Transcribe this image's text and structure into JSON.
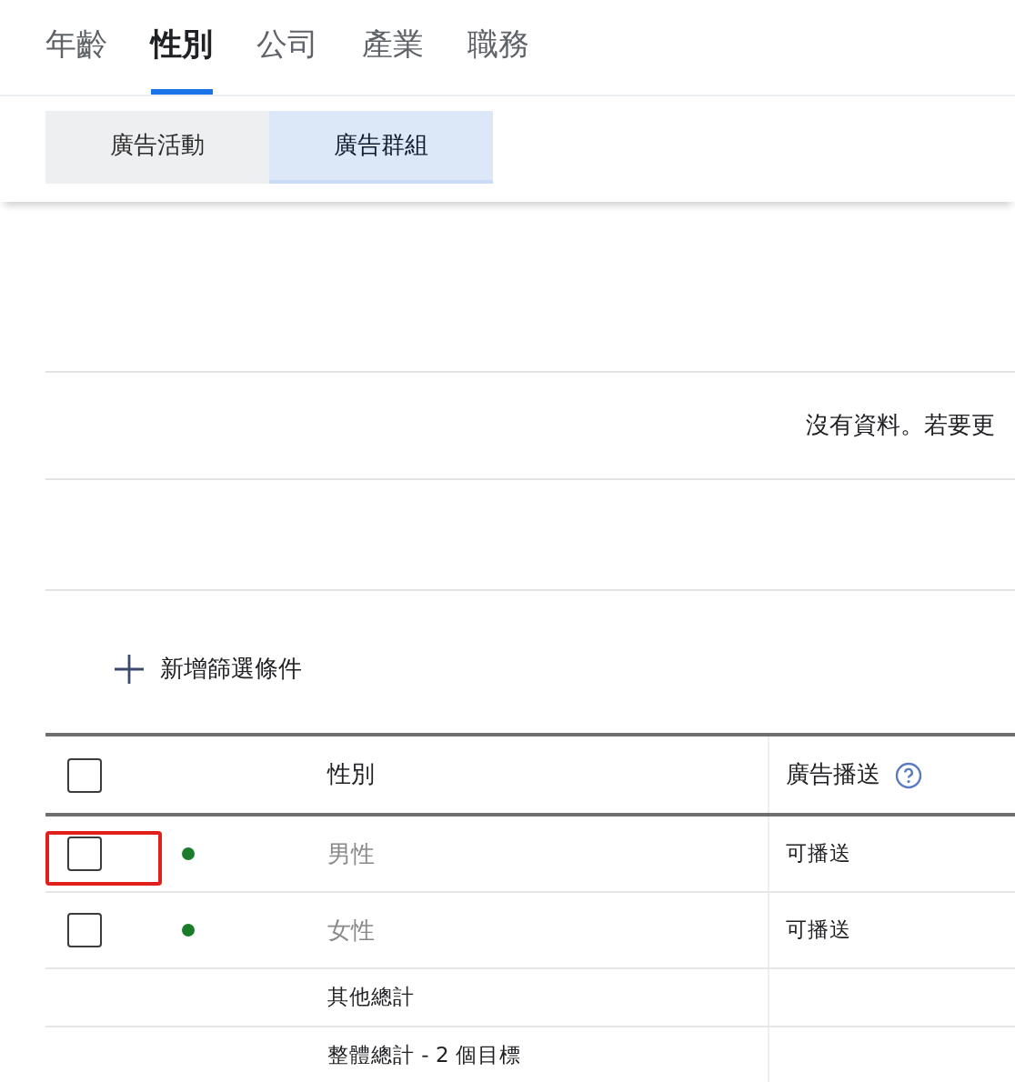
{
  "tabs": [
    {
      "label": "年齡",
      "selected": false
    },
    {
      "label": "性別",
      "selected": true
    },
    {
      "label": "公司",
      "selected": false
    },
    {
      "label": "產業",
      "selected": false
    },
    {
      "label": "職務",
      "selected": false
    }
  ],
  "subtabs": [
    {
      "label": "廣告活動",
      "selected": false
    },
    {
      "label": "廣告群組",
      "selected": true
    }
  ],
  "empty_message": "沒有資料。若要更",
  "add_filter": {
    "label": "新增篩選條件"
  },
  "table": {
    "header_checked": false,
    "columns": [
      "性別",
      "廣告播送"
    ],
    "rows": [
      {
        "kind": "item",
        "checked": false,
        "highlighted": true,
        "color": "#1b7d2b",
        "label": "男性",
        "delivery": "可播送"
      },
      {
        "kind": "item",
        "checked": false,
        "highlighted": false,
        "color": "#1b7d2b",
        "label": "女性",
        "delivery": "可播送"
      },
      {
        "kind": "total",
        "label": "其他總計"
      },
      {
        "kind": "total",
        "label": "整體總計 - 2 個目標"
      }
    ]
  }
}
